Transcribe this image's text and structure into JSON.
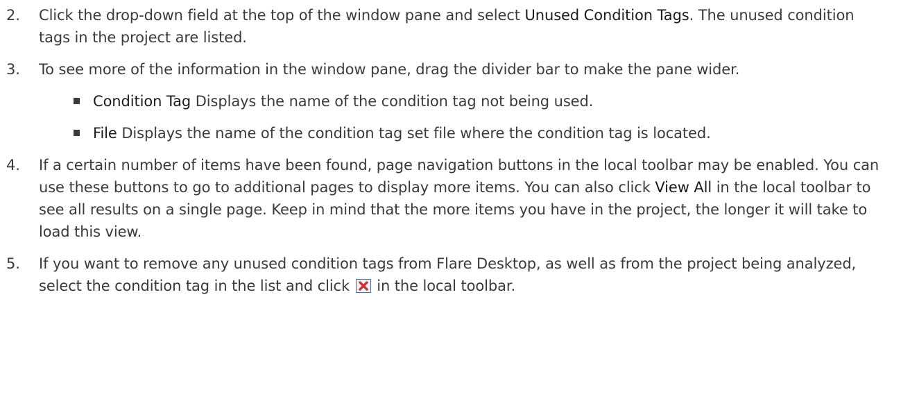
{
  "steps": [
    {
      "num": "2.",
      "parts": [
        {
          "t": "Click the drop-down field at the top of the window pane and select ",
          "b": false
        },
        {
          "t": "Unused Condition Tags",
          "b": true
        },
        {
          "t": ". The unused condition tags in the project are listed.",
          "b": false
        }
      ]
    },
    {
      "num": "3.",
      "parts": [
        {
          "t": "To see more of the information in the window pane, drag the divider bar to make the pane wider.",
          "b": false
        }
      ],
      "bullets": [
        {
          "term": "Condition Tag",
          "desc": " Displays the name of the condition tag not being used."
        },
        {
          "term": "File",
          "desc": " Displays the name of the condition tag set file where the condition tag is located."
        }
      ]
    },
    {
      "num": "4.",
      "parts": [
        {
          "t": "If a certain number of items have been found, page navigation buttons in the local toolbar may be enabled. You can use these buttons to go to additional pages to display more items. You can also click ",
          "b": false
        },
        {
          "t": "View All",
          "b": true
        },
        {
          "t": " in the local toolbar to see all results on a single page. Keep in mind that the more items you have in the project, the longer it will take to load this view.",
          "b": false
        }
      ]
    },
    {
      "num": "5.",
      "parts": [
        {
          "t": "If you want to remove any unused condition tags from Flare Desktop, as well as from the project being analyzed, select the condition tag in the list and click ",
          "b": false
        },
        {
          "icon": "delete-x-icon"
        },
        {
          "t": " in the local toolbar.",
          "b": false
        }
      ]
    }
  ],
  "colors": {
    "text": "#3a3a3a",
    "icon_red": "#d0312d",
    "icon_border": "#4a6fa5"
  }
}
